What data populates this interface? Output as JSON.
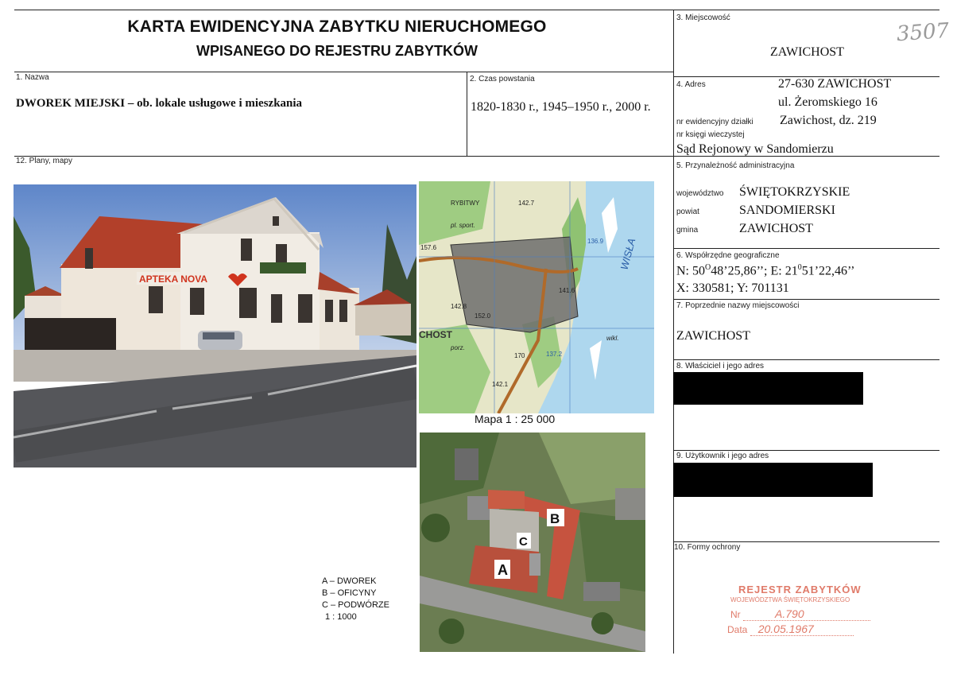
{
  "header": {
    "title_line1": "KARTA EWIDENCYJNA ZABYTKU NIERUCHOMEGO",
    "title_line2": "WPISANEGO DO REJESTRU ZABYTKÓW",
    "handwritten_number": "3507"
  },
  "fields": {
    "name_label": "1. Nazwa",
    "name_value": "DWOREK MIEJSKI – ob. lokale usługowe i mieszkania",
    "date_label": "2. Czas powstania",
    "date_value": "1820-1830 r., 1945–1950 r., 2000 r.",
    "place_label": "3. Miejscowość",
    "place_value": "ZAWICHOST",
    "address_label": "4. Adres",
    "address_line1": "27-630 ZAWICHOST",
    "address_line2": "ul. Żeromskiego 16",
    "parcel_label": "nr ewidencyjny działki",
    "parcel_value": "Zawichost, dz. 219",
    "land_register_label": "nr księgi wieczystej",
    "land_register_value": "Sąd Rejonowy w  Sandomierzu",
    "admin_label": "5. Przynależność administracyjna",
    "voivodeship_label": "województwo",
    "voivodeship_value": "ŚWIĘTOKRZYSKIE",
    "county_label": "powiat",
    "county_value": "SANDOMIERSKI",
    "commune_label": "gmina",
    "commune_value": "ZAWICHOST",
    "coords_label": "6. Współrzędne geograficzne",
    "coords_n": "N: 50",
    "coords_n_deg": "O",
    "coords_n_rest": "48’25,86’’; E: 21",
    "coords_e_deg": "0",
    "coords_e_rest": "51’22,46’’",
    "coords_xy": "X: 330581; Y: 701131",
    "former_names_label": "7. Poprzednie nazwy miejscowości",
    "former_names_value": "ZAWICHOST",
    "owner_label": "8. Właściciel i jego adres",
    "user_label": "9. Użytkownik i jego adres",
    "protection_label": "10. Formy ochrony",
    "plans_label": "12. Plany, mapy"
  },
  "images": {
    "photo_sign": "APTEKA NOVA",
    "map_caption": "Mapa 1 : 25 000",
    "map_labels": [
      "RYBITWY",
      "142.7",
      "pl. sport.",
      "157.6",
      "136.9",
      "WISŁA",
      "141.6",
      "142.8",
      "152.0",
      "CHOST",
      "wikl.",
      "137.2",
      "porz.",
      "142.1",
      "170"
    ],
    "aerial_labels": [
      "A",
      "B",
      "C"
    ]
  },
  "legend": {
    "a": "A – DWOREK",
    "b": "B – OFICYNY",
    "c": "C – PODWÓRZE",
    "scale": "1 : 1000"
  },
  "stamp": {
    "line1": "REJESTR ZABYTKÓW",
    "line2": "WOJEWÓDZTWA ŚWIĘTOKRZYSKIEGO",
    "nr_label": "Nr",
    "nr_value": "A.790",
    "date_label": "Data",
    "date_value": "20.05.1967"
  }
}
